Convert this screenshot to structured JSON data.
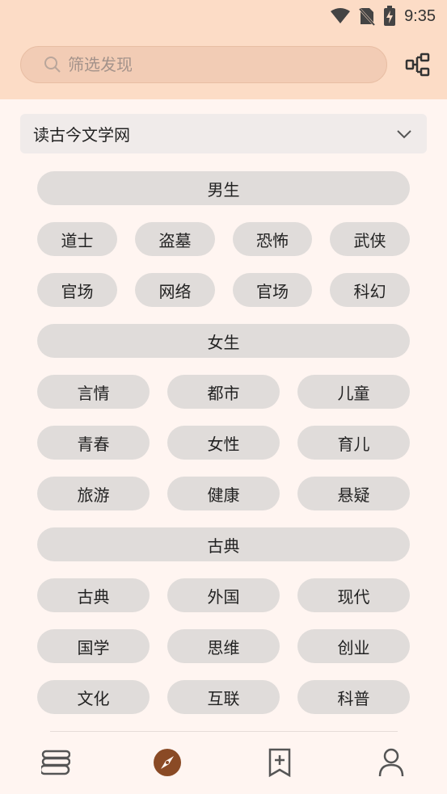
{
  "status": {
    "time": "9:35"
  },
  "search": {
    "placeholder": "筛选发现"
  },
  "source_select": {
    "value": "读古今文学网"
  },
  "groups": [
    {
      "header": "男生",
      "items": [
        "道士",
        "盗墓",
        "恐怖",
        "武侠",
        "官场",
        "网络",
        "官场",
        "科幻"
      ]
    },
    {
      "header": "女生",
      "items": [
        "言情",
        "都市",
        "儿童",
        "青春",
        "女性",
        "育儿",
        "旅游",
        "健康",
        "悬疑"
      ]
    },
    {
      "header": "古典",
      "items": [
        "古典",
        "外国",
        "现代",
        "国学",
        "思维",
        "创业",
        "文化",
        "互联",
        "科普"
      ]
    }
  ],
  "bottom_nav": {
    "items": [
      {
        "icon": "bookshelf-icon",
        "selected": false
      },
      {
        "icon": "compass-icon",
        "selected": true
      },
      {
        "icon": "bookmark-add-icon",
        "selected": false
      },
      {
        "icon": "person-icon",
        "selected": false
      }
    ]
  },
  "colors": {
    "header_bg": "#fcdcc6",
    "page_bg": "#fff5f1",
    "chip_bg": "#e0dcda",
    "accent": "#8a4a25"
  }
}
